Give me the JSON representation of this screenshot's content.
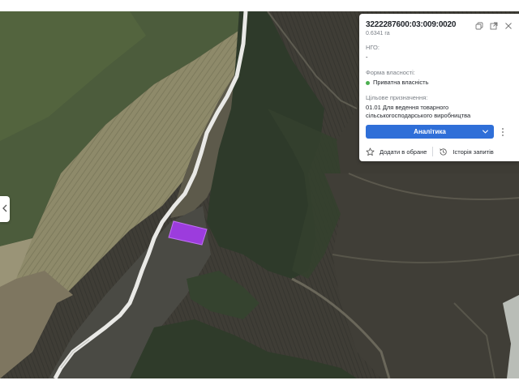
{
  "parcel": {
    "cadastral_number": "3222287600:03:009:0020",
    "area": "0.6341 га"
  },
  "fields": {
    "ngo_label": "НГО:",
    "ngo_value": "-",
    "ownership_label": "Форма власності:",
    "ownership_value": "Приватна власність",
    "purpose_label": "Цільове призначення:",
    "purpose_value": "01.01 Для ведення товарного сільськогосподарського виробництва"
  },
  "actions": {
    "analytics_label": "Аналітика",
    "favorite_label": "Додати в обране",
    "history_label": "Історія запитів"
  },
  "colors": {
    "accent": "#2f6fd8",
    "status_private": "#4caf50",
    "parcel_fill": "#a13ce6"
  },
  "icons": {
    "copy": "copy-icon",
    "share": "external-link-icon",
    "close": "close-icon",
    "more": "more-vertical-icon",
    "star": "star-icon",
    "history": "history-icon",
    "collapse": "chevron-left-icon"
  }
}
